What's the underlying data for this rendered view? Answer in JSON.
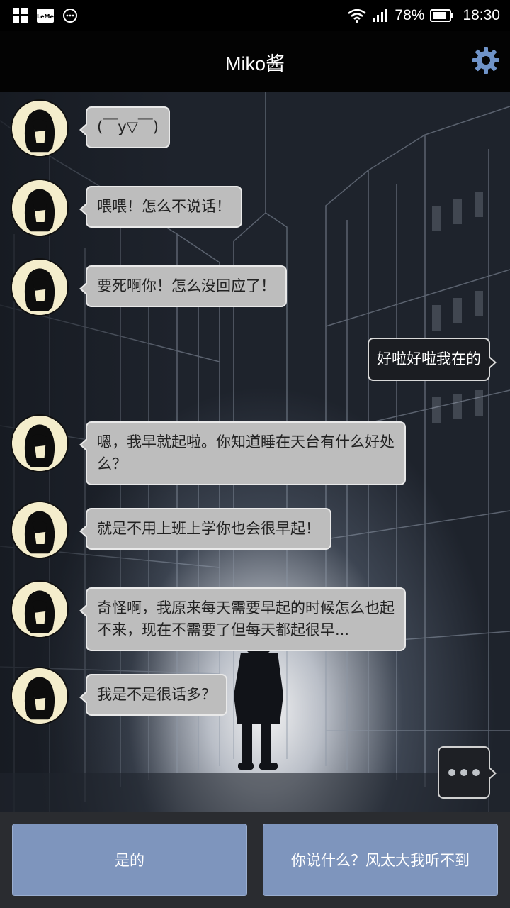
{
  "status_bar": {
    "battery_percent": "78%",
    "time": "18:30",
    "icons": [
      "apps-grid-icon",
      "leme-icon",
      "smile-icon",
      "wifi-icon",
      "signal-icon",
      "battery-icon"
    ]
  },
  "header": {
    "title": "Miko酱",
    "settings_icon": "gear-icon"
  },
  "messages": [
    {
      "sender": "bot",
      "text": "(￣y▽￣)"
    },
    {
      "sender": "bot",
      "text": "喂喂！怎么不说话！"
    },
    {
      "sender": "bot",
      "text": "要死啊你！怎么没回应了！"
    },
    {
      "sender": "user",
      "text": "好啦好啦我在的"
    },
    {
      "sender": "bot",
      "text": "嗯，我早就起啦。你知道睡在天台有什么好处\n么？"
    },
    {
      "sender": "bot",
      "text": "就是不用上班上学你也会很早起！"
    },
    {
      "sender": "bot",
      "text": "奇怪啊，我原来每天需要早起的时候怎么也起\n不来，现在不需要了但每天都起很早..."
    },
    {
      "sender": "bot",
      "text": "我是不是很话多？"
    }
  ],
  "typing_indicator": "more-dots-icon",
  "replies": {
    "option_1": "是的",
    "option_2": "你说什么？风太大我听不到"
  },
  "colors": {
    "bot_bubble": "#bdbdbd",
    "user_bubble": "#1b1d22",
    "reply_button": "#7e95bd",
    "accent_settings": "#6f93c8"
  }
}
